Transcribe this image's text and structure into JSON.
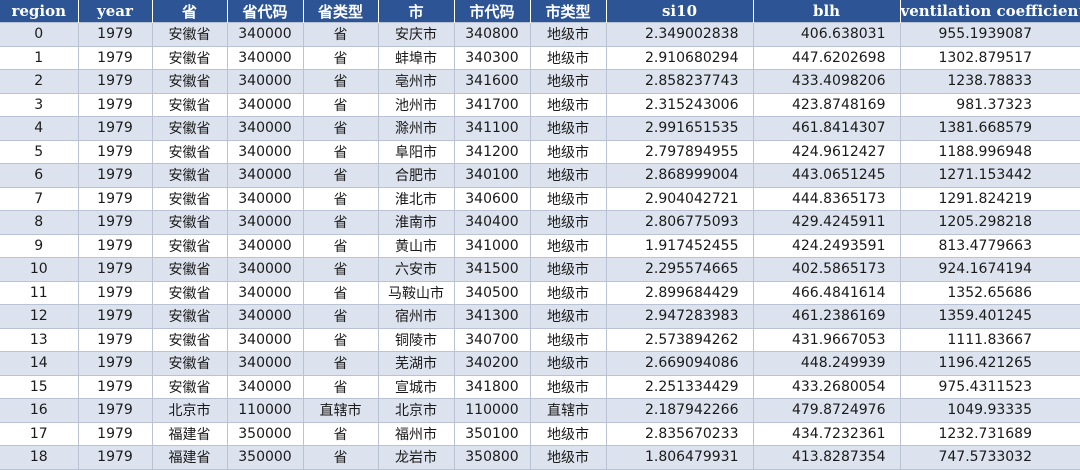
{
  "columns": [
    "region",
    "year",
    "省",
    "省代码",
    "省类型",
    "市",
    "市代码",
    "市类型",
    "si10",
    "blh",
    "ventilation coefficient"
  ],
  "rows": [
    [
      "0",
      "1979",
      "安徽省",
      "340000",
      "省",
      "安庆市",
      "340800",
      "地级市",
      "2.349002838",
      "406.638031",
      "955.1939087"
    ],
    [
      "1",
      "1979",
      "安徽省",
      "340000",
      "省",
      "蚌埠市",
      "340300",
      "地级市",
      "2.910680294",
      "447.6202698",
      "1302.879517"
    ],
    [
      "2",
      "1979",
      "安徽省",
      "340000",
      "省",
      "亳州市",
      "341600",
      "地级市",
      "2.858237743",
      "433.4098206",
      "1238.78833"
    ],
    [
      "3",
      "1979",
      "安徽省",
      "340000",
      "省",
      "池州市",
      "341700",
      "地级市",
      "2.315243006",
      "423.8748169",
      "981.37323"
    ],
    [
      "4",
      "1979",
      "安徽省",
      "340000",
      "省",
      "滁州市",
      "341100",
      "地级市",
      "2.991651535",
      "461.8414307",
      "1381.668579"
    ],
    [
      "5",
      "1979",
      "安徽省",
      "340000",
      "省",
      "阜阳市",
      "341200",
      "地级市",
      "2.797894955",
      "424.9612427",
      "1188.996948"
    ],
    [
      "6",
      "1979",
      "安徽省",
      "340000",
      "省",
      "合肥市",
      "340100",
      "地级市",
      "2.868999004",
      "443.0651245",
      "1271.153442"
    ],
    [
      "7",
      "1979",
      "安徽省",
      "340000",
      "省",
      "淮北市",
      "340600",
      "地级市",
      "2.904042721",
      "444.8365173",
      "1291.824219"
    ],
    [
      "8",
      "1979",
      "安徽省",
      "340000",
      "省",
      "淮南市",
      "340400",
      "地级市",
      "2.806775093",
      "429.4245911",
      "1205.298218"
    ],
    [
      "9",
      "1979",
      "安徽省",
      "340000",
      "省",
      "黄山市",
      "341000",
      "地级市",
      "1.917452455",
      "424.2493591",
      "813.4779663"
    ],
    [
      "10",
      "1979",
      "安徽省",
      "340000",
      "省",
      "六安市",
      "341500",
      "地级市",
      "2.295574665",
      "402.5865173",
      "924.1674194"
    ],
    [
      "11",
      "1979",
      "安徽省",
      "340000",
      "省",
      "马鞍山市",
      "340500",
      "地级市",
      "2.899684429",
      "466.4841614",
      "1352.65686"
    ],
    [
      "12",
      "1979",
      "安徽省",
      "340000",
      "省",
      "宿州市",
      "341300",
      "地级市",
      "2.947283983",
      "461.2386169",
      "1359.401245"
    ],
    [
      "13",
      "1979",
      "安徽省",
      "340000",
      "省",
      "铜陵市",
      "340700",
      "地级市",
      "2.573894262",
      "431.9667053",
      "1111.83667"
    ],
    [
      "14",
      "1979",
      "安徽省",
      "340000",
      "省",
      "芜湖市",
      "340200",
      "地级市",
      "2.669094086",
      "448.249939",
      "1196.421265"
    ],
    [
      "15",
      "1979",
      "安徽省",
      "340000",
      "省",
      "宣城市",
      "341800",
      "地级市",
      "2.251334429",
      "433.2680054",
      "975.4311523"
    ],
    [
      "16",
      "1979",
      "北京市",
      "110000",
      "直辖市",
      "北京市",
      "110000",
      "直辖市",
      "2.187942266",
      "479.8724976",
      "1049.93335"
    ],
    [
      "17",
      "1979",
      "福建省",
      "350000",
      "省",
      "福州市",
      "350100",
      "地级市",
      "2.835670233",
      "434.7232361",
      "1232.731689"
    ],
    [
      "18",
      "1979",
      "福建省",
      "350000",
      "省",
      "龙岩市",
      "350800",
      "地级市",
      "1.806479931",
      "413.8287354",
      "747.5733032"
    ]
  ]
}
